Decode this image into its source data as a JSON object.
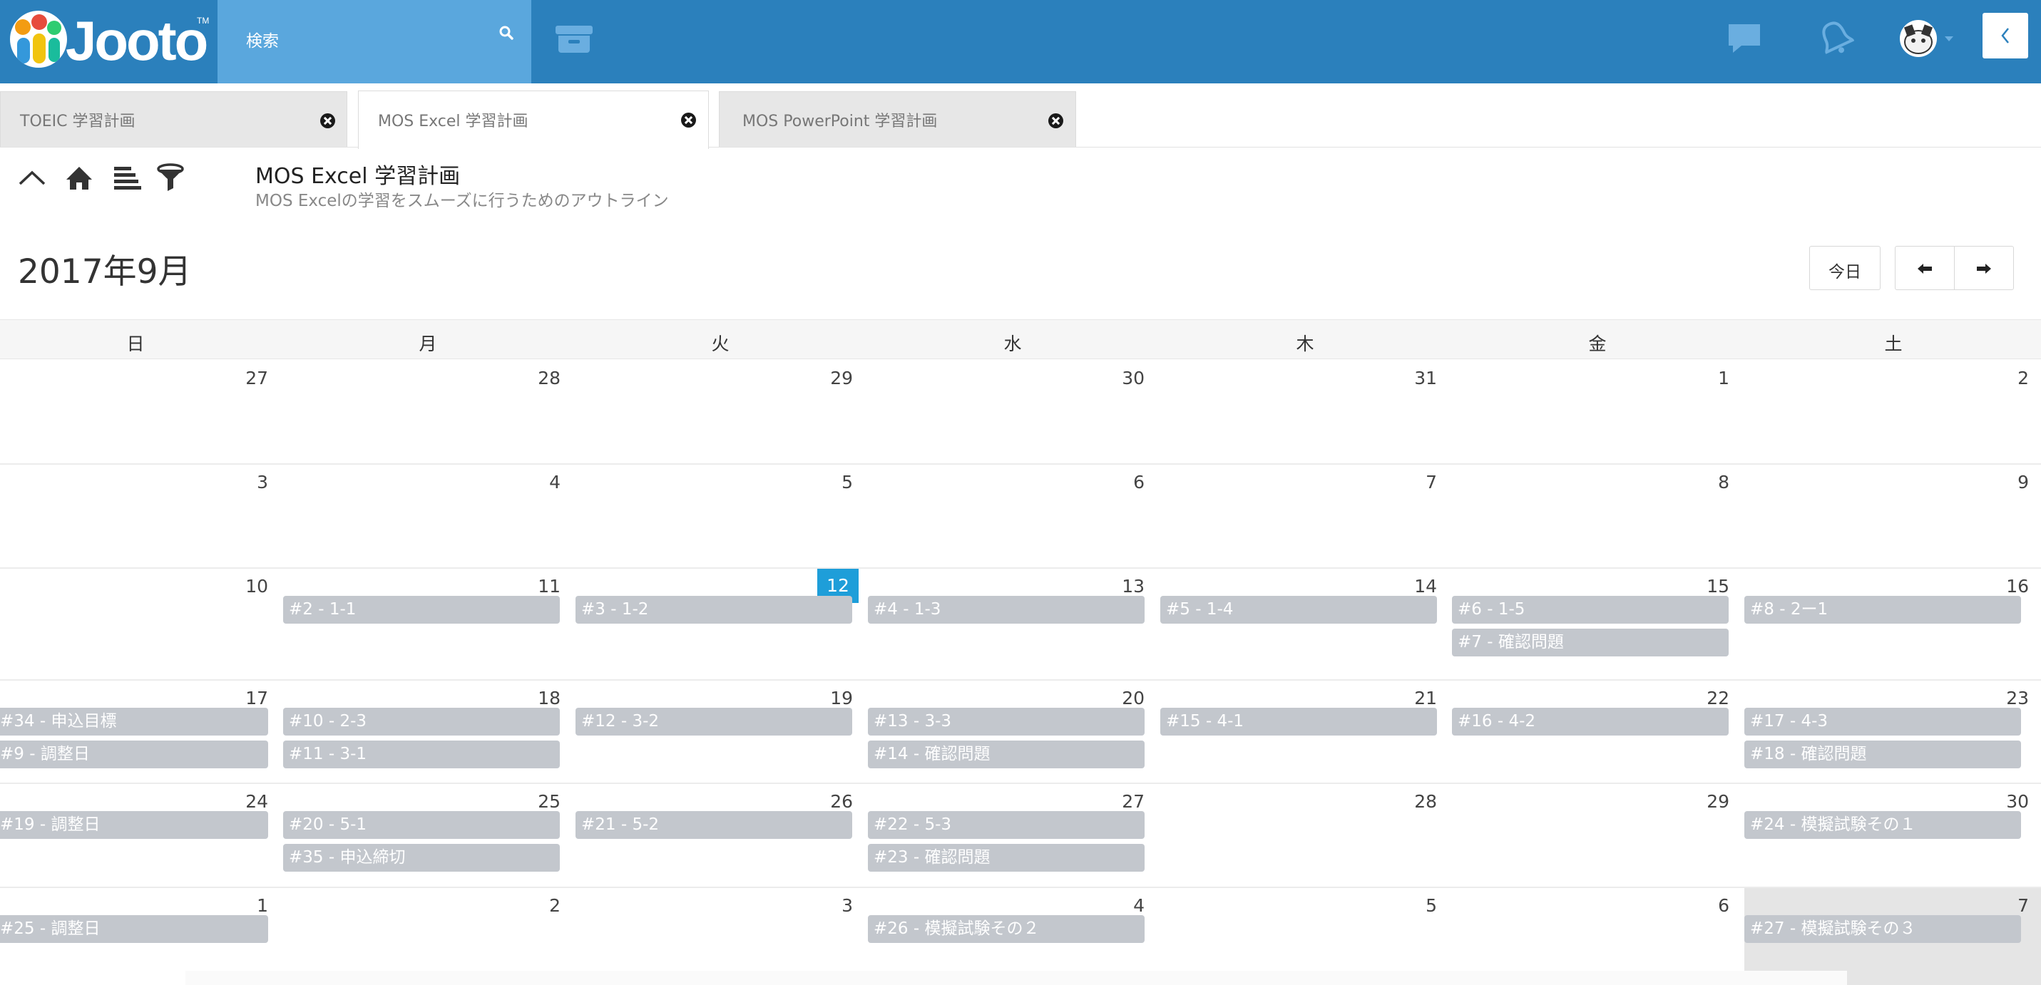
{
  "app": {
    "logo_text": "Jooto",
    "logo_tm": "TM",
    "search_placeholder": "検索",
    "colors": {
      "topbar": "#2b80bc",
      "search": "#5aa7dd",
      "today": "#1e9ed9",
      "event": "#c3c7cd"
    },
    "icons": [
      "search-icon",
      "archive-icon",
      "chat-icon",
      "bell-icon",
      "avatar",
      "chevron-left-icon"
    ]
  },
  "tabs": [
    {
      "label": "TOEIC 学習計画",
      "active": false
    },
    {
      "label": "MOS Excel 学習計画",
      "active": true
    },
    {
      "label": "MOS PowerPoint 学習計画",
      "active": false
    }
  ],
  "toolbar": {
    "icons": [
      "collapse-icon",
      "home-icon",
      "outline-icon",
      "filter-icon"
    ]
  },
  "project": {
    "title": "MOS Excel 学習計画",
    "description": "MOS Excelの学習をスムーズに行うためのアウトライン"
  },
  "calendar": {
    "month_title": "2017年9月",
    "today_label": "今日",
    "weekdays": [
      "日",
      "月",
      "火",
      "水",
      "木",
      "金",
      "土"
    ],
    "today_date": 12,
    "weeks": [
      {
        "days": [
          27,
          28,
          29,
          30,
          31,
          1,
          2
        ],
        "events": []
      },
      {
        "days": [
          3,
          4,
          5,
          6,
          7,
          8,
          9
        ],
        "events": []
      },
      {
        "days": [
          10,
          11,
          12,
          13,
          14,
          15,
          16
        ],
        "events": [
          {
            "col": 1,
            "slot": 0,
            "label": "#2 - 1-1"
          },
          {
            "col": 2,
            "slot": 0,
            "label": "#3 - 1-2"
          },
          {
            "col": 3,
            "slot": 0,
            "label": "#4 - 1-3"
          },
          {
            "col": 4,
            "slot": 0,
            "label": "#5 - 1-4"
          },
          {
            "col": 5,
            "slot": 0,
            "label": "#6 - 1-5"
          },
          {
            "col": 5,
            "slot": 1,
            "label": "#7 - 確認問題"
          },
          {
            "col": 6,
            "slot": 0,
            "label": "#8 - 2ー1"
          }
        ]
      },
      {
        "days": [
          17,
          18,
          19,
          20,
          21,
          22,
          23
        ],
        "events": [
          {
            "col": 0,
            "slot": 0,
            "label": "#34 - 申込目標"
          },
          {
            "col": 0,
            "slot": 1,
            "label": "#9 - 調整日"
          },
          {
            "col": 1,
            "slot": 0,
            "label": "#10 - 2-3"
          },
          {
            "col": 1,
            "slot": 1,
            "label": "#11 - 3-1"
          },
          {
            "col": 2,
            "slot": 0,
            "label": "#12 - 3-2"
          },
          {
            "col": 3,
            "slot": 0,
            "label": "#13 - 3-3"
          },
          {
            "col": 3,
            "slot": 1,
            "label": "#14 - 確認問題"
          },
          {
            "col": 4,
            "slot": 0,
            "label": "#15 - 4-1"
          },
          {
            "col": 5,
            "slot": 0,
            "label": "#16 - 4-2"
          },
          {
            "col": 6,
            "slot": 0,
            "label": "#17 - 4-3"
          },
          {
            "col": 6,
            "slot": 1,
            "label": "#18 - 確認問題"
          }
        ]
      },
      {
        "days": [
          24,
          25,
          26,
          27,
          28,
          29,
          30
        ],
        "events": [
          {
            "col": 0,
            "slot": 0,
            "label": "#19 - 調整日"
          },
          {
            "col": 1,
            "slot": 0,
            "label": "#20 - 5-1"
          },
          {
            "col": 1,
            "slot": 1,
            "label": "#35 - 申込締切"
          },
          {
            "col": 2,
            "slot": 0,
            "label": "#21 - 5-2"
          },
          {
            "col": 3,
            "slot": 0,
            "label": "#22 - 5-3"
          },
          {
            "col": 3,
            "slot": 1,
            "label": "#23 - 確認問題"
          },
          {
            "col": 6,
            "slot": 0,
            "label": "#24 - 模擬試験その１"
          }
        ]
      },
      {
        "days": [
          1,
          2,
          3,
          4,
          5,
          6,
          7
        ],
        "events": [
          {
            "col": 0,
            "slot": 0,
            "label": "#25 - 調整日"
          },
          {
            "col": 3,
            "slot": 0,
            "label": "#26 - 模擬試験その２"
          },
          {
            "col": 6,
            "slot": 0,
            "label": "#27 - 模擬試験その３"
          }
        ]
      }
    ]
  }
}
